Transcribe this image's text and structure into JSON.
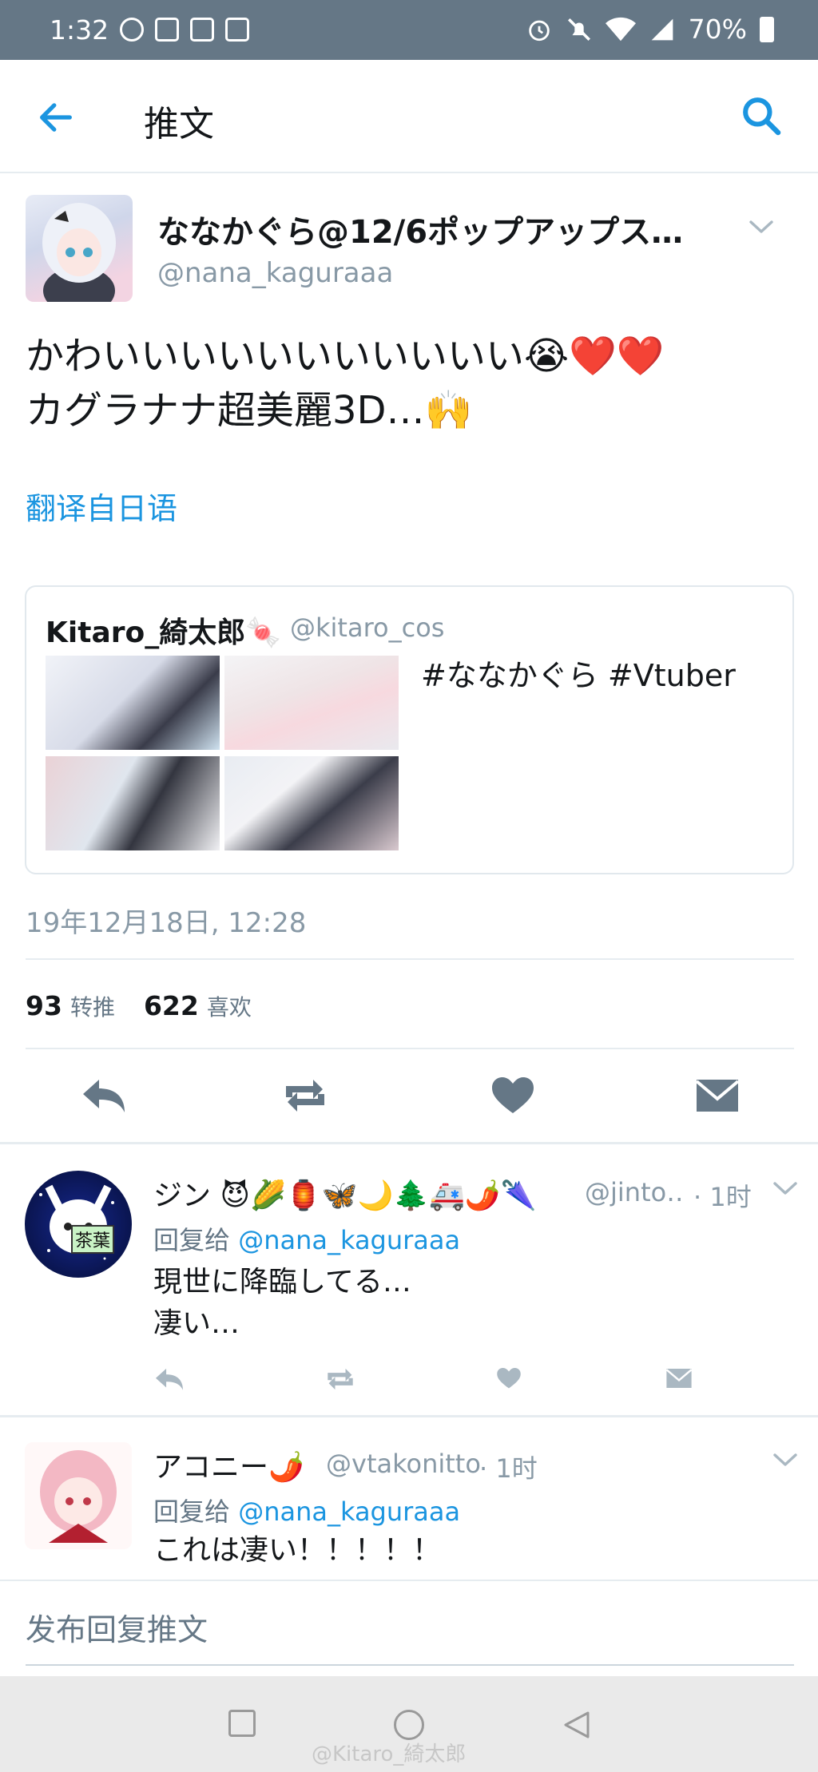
{
  "status_bar": {
    "time": "1:32",
    "battery": "70%"
  },
  "app_bar": {
    "title": "推文"
  },
  "tweet": {
    "display_name": "ななかぐら@12/6ポップアップス…",
    "handle": "@nana_kaguraaa",
    "text_line1": "かわいいいいいいいいいいい😭❤️❤️",
    "text_line2": "カグラナナ超美麗3D…🙌",
    "translate_link": "翻译自日语",
    "quote": {
      "display_name": "Kitaro_綺太郎🍬",
      "handle": "@kitaro_cos",
      "text": "#ななかぐら #Vtuber"
    },
    "timestamp": "19年12月18日, 12:28",
    "retweets_count": "93",
    "retweets_label": "转推",
    "likes_count": "622",
    "likes_label": "喜欢"
  },
  "replies": [
    {
      "display_name": "ジン 😈🌽🏮🦋🌙🌲🚑🌶️🌂",
      "handle": "@jinto…",
      "time": "· 1时",
      "reply_prefix": "回复给",
      "reply_to": "@nana_kaguraaa",
      "text_line1": "現世に降臨してる…",
      "text_line2": "凄い…",
      "avatar_badge": "茶葉"
    },
    {
      "display_name": "アコニー🌶️",
      "handle": "@vtakonitto",
      "time": "· 1时",
      "reply_prefix": "回复给",
      "reply_to": "@nana_kaguraaa",
      "text_line1": "これは凄い！！！！！"
    }
  ],
  "compose": {
    "placeholder": "发布回复推文"
  },
  "watermark": "@Kitaro_綺太郎",
  "colors": {
    "accent": "#1b95e0",
    "status_bar": "#657786",
    "secondary_text": "#8899a6"
  }
}
